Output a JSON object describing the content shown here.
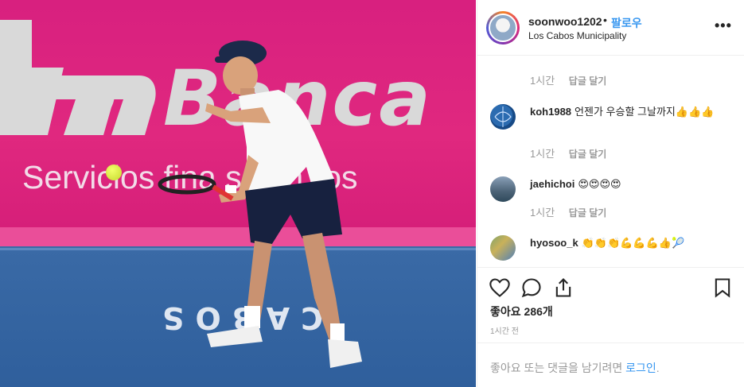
{
  "post": {
    "username": "soonwoo1202",
    "separator": "•",
    "follow_label": "팔로우",
    "location": "Los Cabos Municipality",
    "more_label": "•••"
  },
  "photo": {
    "banner_brand": "Banca",
    "banner_subtitle": "Servicios fina   s con ros",
    "court_text": "CABOS"
  },
  "comments": [
    {
      "meta_time": "1시간",
      "meta_reply": "답글 달기"
    },
    {
      "username": "koh1988",
      "text": "언젠가 우승할 그날까지👍👍👍",
      "meta_time": "1시간",
      "meta_reply": "답글 달기"
    },
    {
      "username": "jaehichoi",
      "text": "😍😍😍😍",
      "meta_time": "1시간",
      "meta_reply": "답글 달기"
    },
    {
      "username": "hyosoo_k",
      "text": "👏👏👏💪💪💪👍🎾"
    }
  ],
  "actions": {
    "likes_text": "좋아요 286개",
    "time_ago": "1시간 전"
  },
  "footer": {
    "prompt": "좋아요 또는 댓글을 남기려면 ",
    "login_label": "로그인",
    "period": "."
  },
  "colors": {
    "banner_pink": "#e0287f",
    "court_blue": "#3a6aa6",
    "link_blue": "#3897f0"
  }
}
